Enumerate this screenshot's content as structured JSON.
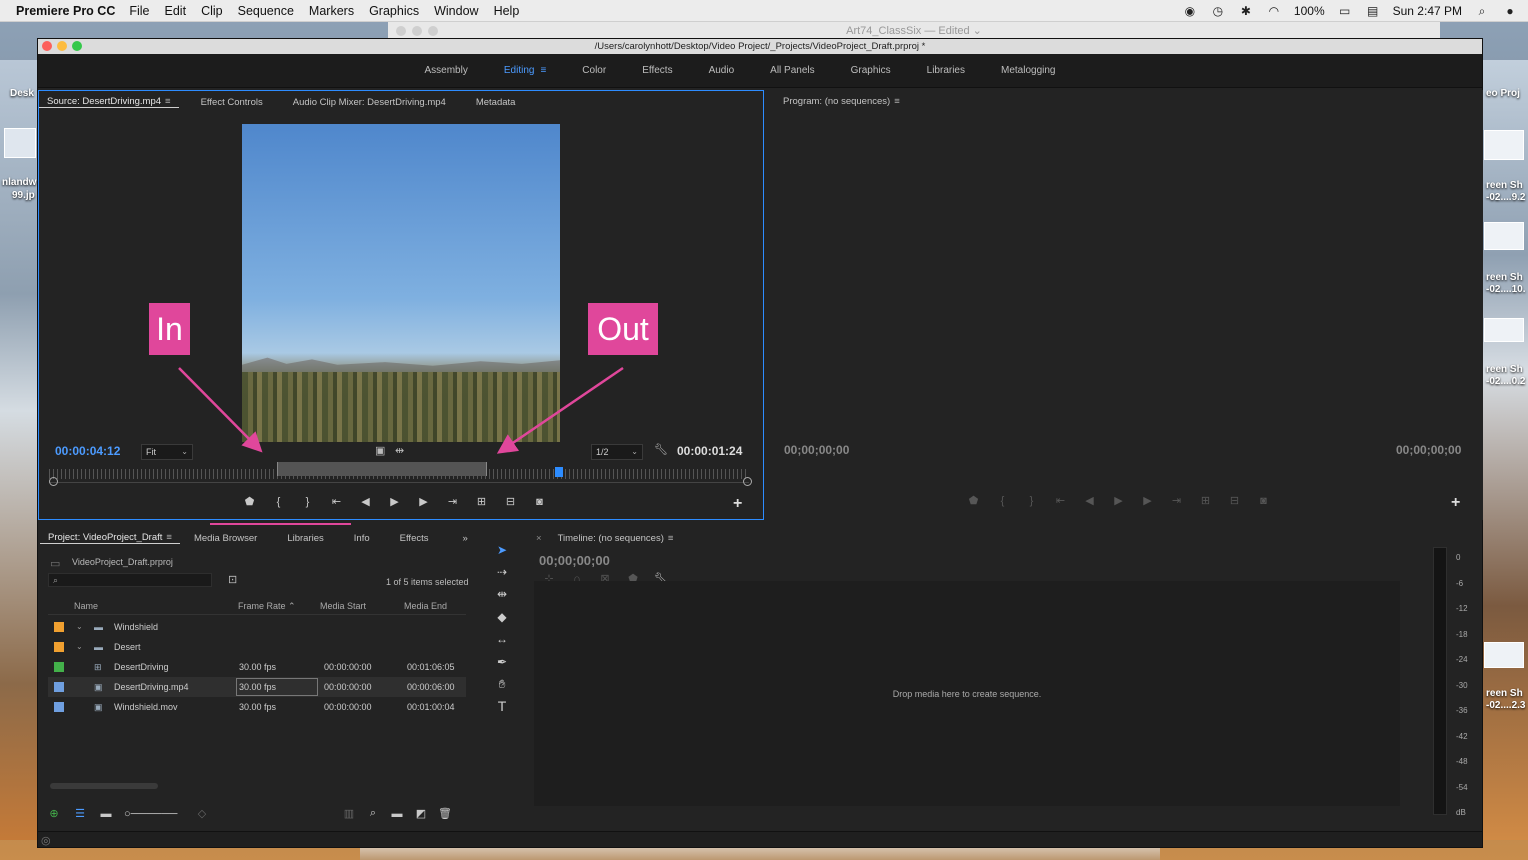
{
  "menubar": {
    "app": "Premiere Pro CC",
    "items": [
      "File",
      "Edit",
      "Clip",
      "Sequence",
      "Markers",
      "Graphics",
      "Window",
      "Help"
    ],
    "battery": "100%",
    "clock": "Sun 2:47 PM"
  },
  "background_window": {
    "title": "Art74_ClassSix — Edited ⌄"
  },
  "desktop": {
    "left_labels": [
      "Desk",
      "nlandw",
      "99.jp"
    ],
    "right_labels": [
      "eo Proj",
      "reen Sh",
      "-02....9.2",
      "reen Sh",
      "-02....10.",
      "reen Sh",
      "-02....0.2",
      "reen Sh",
      "-02....2.3"
    ]
  },
  "window": {
    "title": "/Users/carolynhott/Desktop/Video Project/_Projects/VideoProject_Draft.prproj *",
    "workspaces": [
      "Assembly",
      "Editing",
      "Color",
      "Effects",
      "Audio",
      "All Panels",
      "Graphics",
      "Libraries",
      "Metalogging"
    ],
    "active_workspace": "Editing",
    "accent_color": "#2d8cff",
    "annotation_color": "#e0479b"
  },
  "source": {
    "tabs": [
      "Source: DesertDriving.mp4",
      "Effect Controls",
      "Audio Clip Mixer: DesertDriving.mp4",
      "Metadata"
    ],
    "timecode_in": "00:00:04:12",
    "fit": "Fit",
    "resolution": "1/2",
    "duration": "00:00:01:24",
    "annotation_in": "In",
    "annotation_out": "Out"
  },
  "program": {
    "tab": "Program: (no sequences)",
    "timecode_left": "00;00;00;00",
    "timecode_right": "00;00;00;00"
  },
  "project": {
    "tabs": [
      "Project: VideoProject_Draft",
      "Media Browser",
      "Libraries",
      "Info",
      "Effects"
    ],
    "file": "VideoProject_Draft.prproj",
    "selection_info": "1 of 5 items selected",
    "columns": [
      "Name",
      "Frame Rate",
      "Media Start",
      "Media End"
    ],
    "rows": [
      {
        "name": "Windshield",
        "type": "bin",
        "color": "#f0a030",
        "rate": "",
        "start": "",
        "end": ""
      },
      {
        "name": "Desert",
        "type": "bin",
        "color": "#f0a030",
        "rate": "",
        "start": "",
        "end": ""
      },
      {
        "name": "DesertDriving",
        "type": "sequence",
        "color": "#43b04a",
        "rate": "30.00 fps",
        "start": "00:00:00:00",
        "end": "00:01:06:05"
      },
      {
        "name": "DesertDriving.mp4",
        "type": "clip",
        "color": "#6f9fe0",
        "rate": "30.00 fps",
        "start": "00:00:00:00",
        "end": "00:00:06:00"
      },
      {
        "name": "Windshield.mov",
        "type": "clip",
        "color": "#6f9fe0",
        "rate": "30.00 fps",
        "start": "00:00:00:00",
        "end": "00:01:00:04"
      }
    ]
  },
  "timeline": {
    "tab": "Timeline: (no sequences)",
    "timecode": "00;00;00;00",
    "empty_message": "Drop media here to create sequence."
  },
  "meter": {
    "labels": [
      "0",
      "-6",
      "-12",
      "-18",
      "-24",
      "-30",
      "-36",
      "-42",
      "-48",
      "-54",
      "dB"
    ]
  }
}
